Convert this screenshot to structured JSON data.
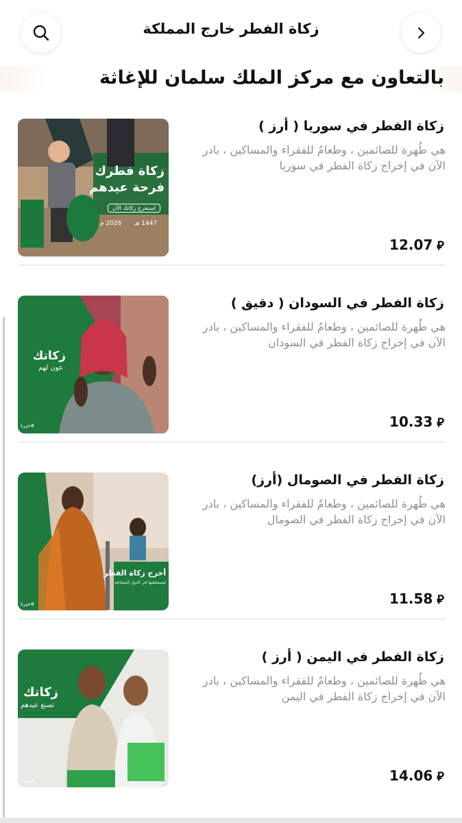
{
  "header": {
    "title": "زكاة الفطر خارج المملكة",
    "search_icon": "search-icon",
    "forward_icon": "chevron-right-icon"
  },
  "section": {
    "title": "بالتعاون مع مركز الملك سلمان للإغاثة"
  },
  "products": [
    {
      "title": "زكاة الفطر في سوريا ( أرز )",
      "description": "هي طُهرة للصائمين ، وطعامٌ للفقراء والمساكين ، بادر الآن في إخراج زكاة الفطر في سوريا",
      "price": "12.07",
      "currency_icon": "riyal-icon",
      "image": {
        "line1": "زكاة فطرك",
        "line2": "فرحة عيدهم",
        "cta": "استخرج زكاتك الآن",
        "year_hijri": "1447 هـ",
        "year_greg": "2026 م"
      }
    },
    {
      "title": "زكاة الفطر في السودان ( دقيق )",
      "description": "هي طُهرة للصائمين ، وطعامٌ للفقراء والمساكين ، بادر الآن في إخراج زكاة الفطر في السودان",
      "price": "10.33",
      "currency_icon": "riyal-icon",
      "image": {
        "line1": "زكاتك",
        "line2": "عون لهم",
        "tag": "#خيرنا"
      }
    },
    {
      "title": "زكاة الفطر في الصومال (أرز)",
      "description": "هي طُهرة للصائمين ، وطعامٌ للفقراء والمساكين ، بادر الآن في إخراج زكاة الفطر في الصومال",
      "price": "11.58",
      "currency_icon": "riyal-icon",
      "image": {
        "line1": "أخرج زكاة الفطر",
        "line2": "لمستحقيها في الدول المحتاجة",
        "tag": "#خيرنا"
      }
    },
    {
      "title": "زكاة الفطر في اليمن ( أرز )",
      "description": "هي طُهرة للصائمين ، وطعامٌ للفقراء والمساكين ، بادر الآن في إخراج زكاة الفطر في اليمن",
      "price": "14.06",
      "currency_icon": "riyal-icon",
      "image": {
        "line1": "زكاتك",
        "line2": "تصنع عيدهم",
        "tag": "#خيرنا"
      }
    }
  ],
  "colors": {
    "brand_green": "#1f7a3c",
    "text_primary": "#111111",
    "text_secondary": "#8e8e8e",
    "divider": "#d9d9d9"
  }
}
